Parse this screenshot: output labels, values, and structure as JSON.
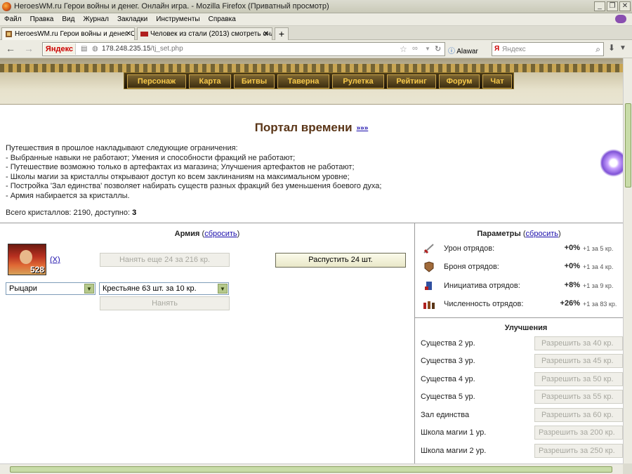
{
  "window": {
    "title": "HeroesWM.ru Герои войны и денег. Онлайн игра. - Mozilla Firefox (Приватный просмотр)"
  },
  "menu": [
    "Файл",
    "Правка",
    "Вид",
    "Журнал",
    "Закладки",
    "Инструменты",
    "Справка"
  ],
  "tabs": [
    {
      "label": "HeroesWM.ru Герои войны и денег. Он..."
    },
    {
      "label": "Человек из стали (2013) смотреть онл..."
    }
  ],
  "address": {
    "host": "178.248.235.15",
    "path": "/tj_set.php",
    "badge": "Яндекс"
  },
  "toolbar": {
    "alawar_label": "Alawar",
    "search_placeholder": "Яндекс"
  },
  "game_nav": [
    "Персонаж",
    "Карта",
    "Битвы",
    "Таверна",
    "Рулетка",
    "Рейтинг",
    "Форум",
    "Чат"
  ],
  "page": {
    "title": "Портал времени",
    "title_link": "»»»",
    "restrictions": [
      "Путешествия в прошлое накладывают следующие ограничения:",
      "- Выбранные навыки не работают; Умения и способности фракций не работают;",
      "- Путешествие возможно только в артефактах из магазина; Улучшения артефактов не работают;",
      "- Школы магии за кристаллы открывают доступ ко всем заклинаниям на максимальном уровне;",
      "- Постройка 'Зал единства' позволяет набирать существ разных фракций без уменьшения боевого духа;",
      "- Армия набирается за кристаллы."
    ],
    "crystals_prefix": "Всего кристаллов: 2190, доступно: ",
    "crystals_available": "3"
  },
  "army": {
    "title": "Армия",
    "reset": "сбросить",
    "unit_count": "528",
    "remove_link": "(X)",
    "hire_more_button": "Нанять еще 24 за 216 кр.",
    "dismiss_button": "Распустить 24 шт.",
    "faction_select": "Рыцари",
    "unit_select": "Крестьяне 63 шт. за 10 кр.",
    "hire_button": "Нанять"
  },
  "params": {
    "title": "Параметры",
    "reset": "сбросить",
    "rows": [
      {
        "label": "Урон отрядов:",
        "value": "+0%",
        "step": "+1 за 5 кр."
      },
      {
        "label": "Броня отрядов:",
        "value": "+0%",
        "step": "+1 за 4 кр."
      },
      {
        "label": "Инициатива отрядов:",
        "value": "+8%",
        "step": "+1 за 9 кр."
      },
      {
        "label": "Численность отрядов:",
        "value": "+26%",
        "step": "+1 за 83 кр."
      }
    ]
  },
  "upgrades": {
    "title": "Улучшения",
    "rows": [
      {
        "label": "Существа 2 ур.",
        "button": "Разрешить за 40 кр."
      },
      {
        "label": "Существа 3 ур.",
        "button": "Разрешить за 45 кр."
      },
      {
        "label": "Существа 4 ур.",
        "button": "Разрешить за 50 кр."
      },
      {
        "label": "Существа 5 ур.",
        "button": "Разрешить за 55 кр."
      },
      {
        "label": "Зал единства",
        "button": "Разрешить за 60 кр."
      },
      {
        "label": "Школа магии 1 ур.",
        "button": "Разрешить за 200 кр."
      },
      {
        "label": "Школа магии 2 ур.",
        "button": "Разрешить за 250 кр."
      }
    ]
  },
  "colors": {
    "title_brown": "#5a3517",
    "nav_gold": "#f6c84a",
    "link_blue": "#1a0dab"
  }
}
